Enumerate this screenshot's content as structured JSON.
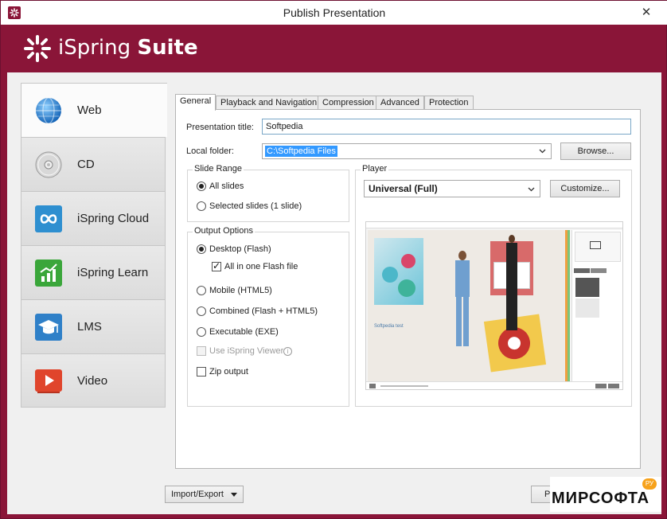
{
  "window": {
    "title": "Publish Presentation",
    "close_glyph": "✕"
  },
  "brand": {
    "name_light": "iSpring ",
    "name_bold": "Suite",
    "color": "#8a1538"
  },
  "sidebar": {
    "items": [
      {
        "label": "Web",
        "icon": "globe-icon",
        "active": true
      },
      {
        "label": "CD",
        "icon": "disc-icon"
      },
      {
        "label": "iSpring Cloud",
        "icon": "cloud-infinity-icon"
      },
      {
        "label": "iSpring Learn",
        "icon": "chart-icon"
      },
      {
        "label": "LMS",
        "icon": "graduation-cap-icon"
      },
      {
        "label": "Video",
        "icon": "video-play-icon"
      }
    ]
  },
  "tabs": [
    "General",
    "Playback and Navigation",
    "Compression",
    "Advanced",
    "Protection"
  ],
  "general": {
    "presentation_title_label": "Presentation title:",
    "presentation_title_value": "Softpedia",
    "local_folder_label": "Local folder:",
    "local_folder_value": "C:\\Softpedia Files",
    "browse_label": "Browse...",
    "slide_range": {
      "title": "Slide Range",
      "all_slides": "All slides",
      "selected_slides": "Selected slides (1 slide)"
    },
    "output_options": {
      "title": "Output Options",
      "desktop": "Desktop (Flash)",
      "all_in_one": "All in one Flash file",
      "mobile": "Mobile (HTML5)",
      "combined": "Combined (Flash + HTML5)",
      "executable": "Executable (EXE)",
      "use_viewer": "Use iSpring Viewer",
      "zip_output": "Zip output"
    },
    "player": {
      "title": "Player",
      "selected": "Universal (Full)",
      "customize_label": "Customize...",
      "preview_caption": "Softpedia test"
    }
  },
  "footer": {
    "import_export_label": "Import/Export",
    "publish_label_partial": "P"
  },
  "watermark": {
    "text": "МИРСОФТА",
    "badge": "РУ"
  }
}
